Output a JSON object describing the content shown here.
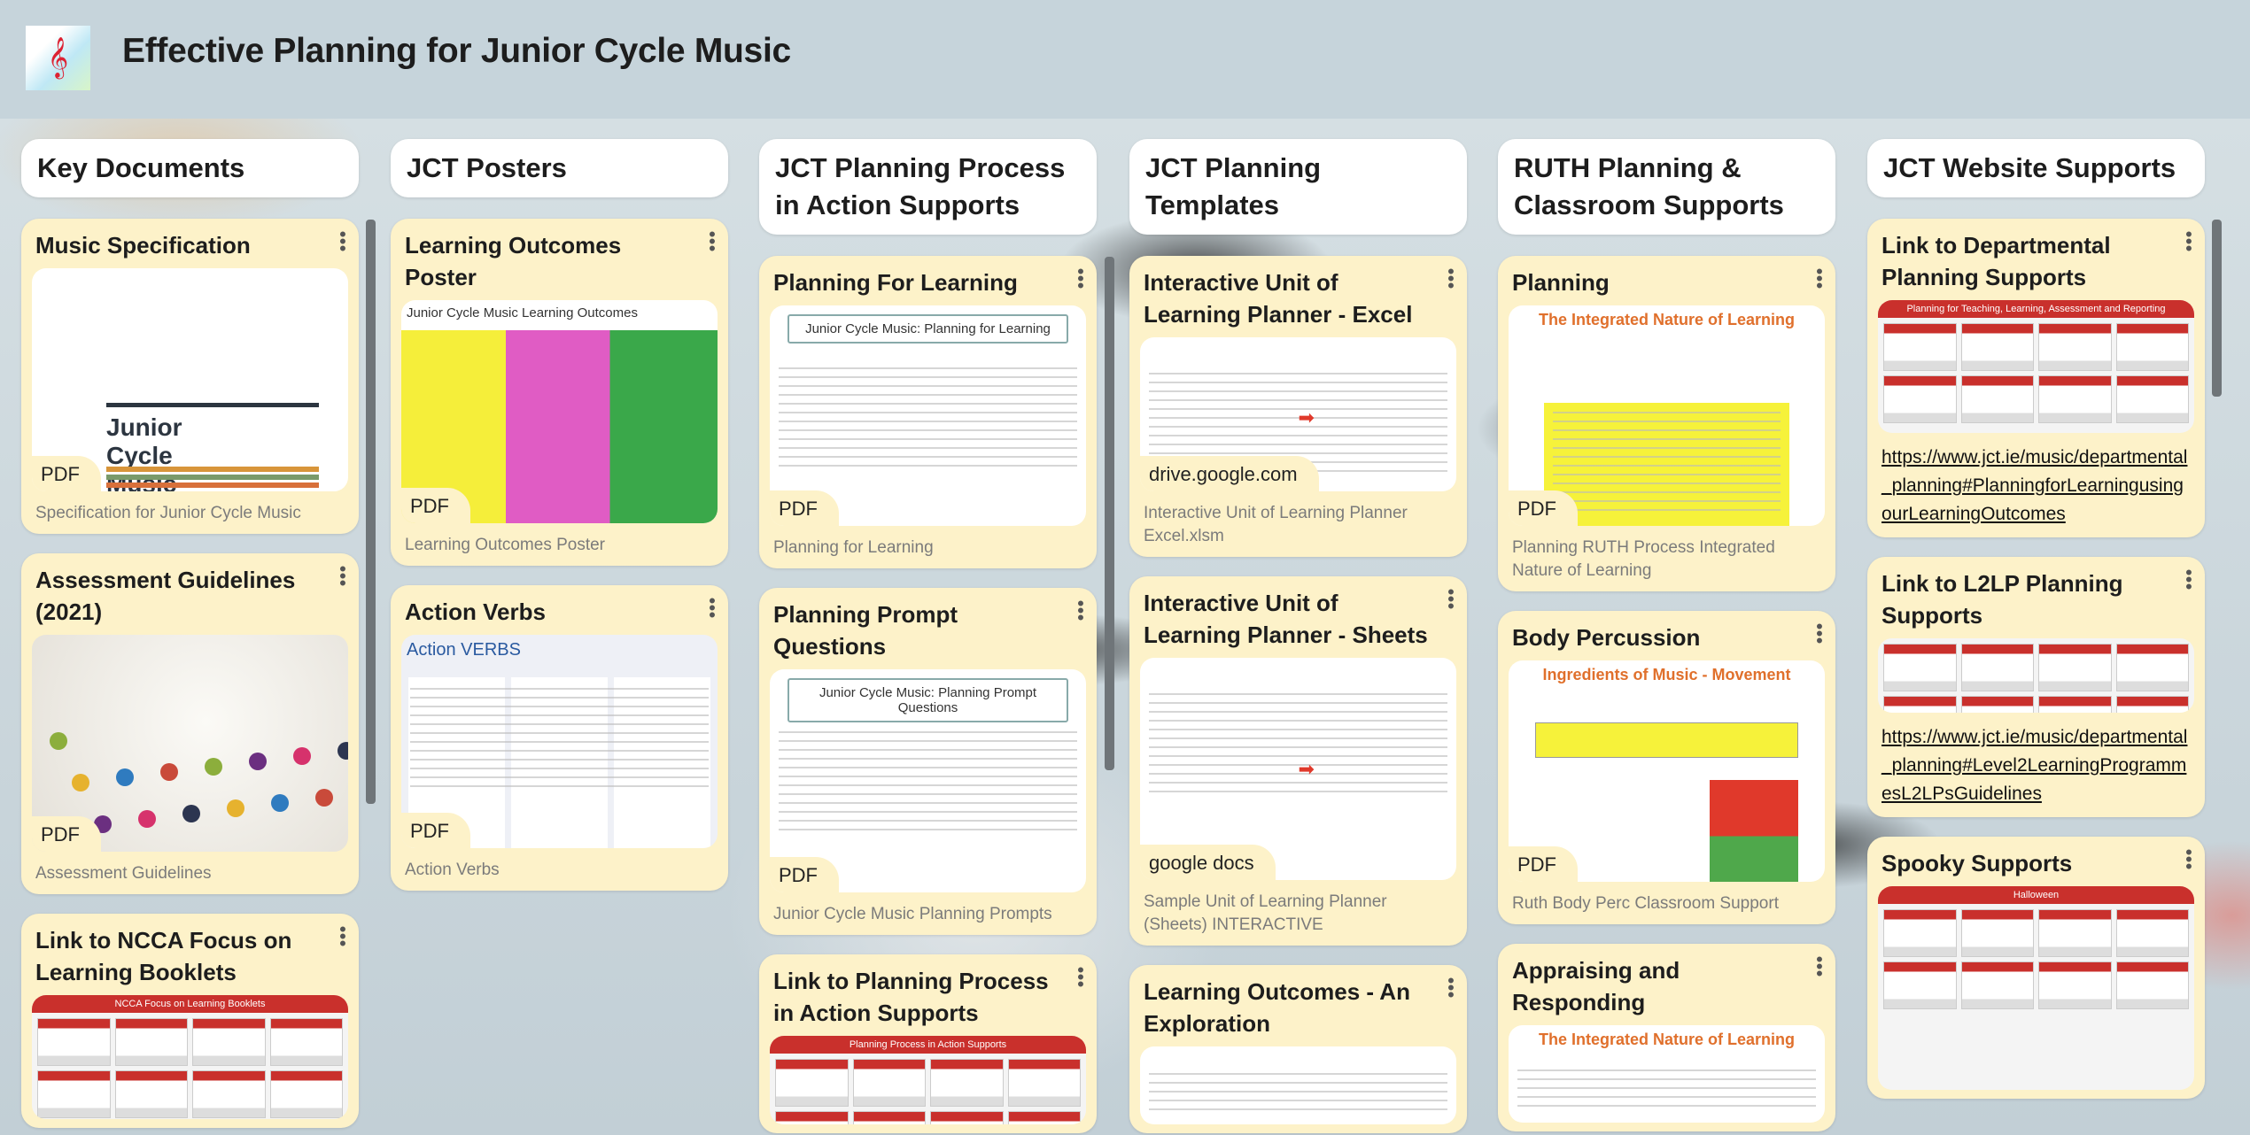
{
  "header": {
    "title": "Effective Planning for Junior Cycle Music",
    "logo_icon": "treble-clef-icon"
  },
  "colors": {
    "card": "#fdf2c9",
    "header_bg": "#c6d4db",
    "column_header": "#ffffff"
  },
  "columns": [
    {
      "title": "Key Documents",
      "cards": [
        {
          "title": "Music Specification",
          "badge": "PDF",
          "caption": "Specification for Junior Cycle Music",
          "thumb_heading": "Junior Cycle Music"
        },
        {
          "title": "Assessment Guidelines (2021)",
          "badge": "PDF",
          "caption": "Assessment Guidelines"
        },
        {
          "title": "Link to NCCA Focus on Learning Booklets",
          "thumb_heading": "NCCA Focus on Learning Booklets"
        }
      ]
    },
    {
      "title": "JCT Posters",
      "cards": [
        {
          "title": "Learning Outcomes Poster",
          "badge": "PDF",
          "caption": "Learning Outcomes Poster",
          "thumb_heading": "Junior Cycle Music Learning Outcomes"
        },
        {
          "title": "Action Verbs",
          "badge": "PDF",
          "caption": "Action Verbs",
          "thumb_heading": "Action VERBS"
        }
      ]
    },
    {
      "title": "JCT Planning Process in Action Supports",
      "cards": [
        {
          "title": "Planning For Learning",
          "badge": "PDF",
          "caption": "Planning for Learning",
          "thumb_heading": "Junior Cycle Music: Planning for Learning"
        },
        {
          "title": "Planning Prompt Questions",
          "badge": "PDF",
          "caption": "Junior Cycle Music Planning Prompts",
          "thumb_heading": "Junior Cycle Music: Planning Prompt Questions"
        },
        {
          "title": "Link to Planning Process in Action Supports",
          "thumb_heading": "Planning Process in Action Supports"
        }
      ]
    },
    {
      "title": "JCT Planning Templates",
      "cards": [
        {
          "title": "Interactive Unit of Learning Planner - Excel",
          "badge": "drive.google.com",
          "caption": "Interactive Unit of Learning Planner Excel.xlsm"
        },
        {
          "title": "Interactive Unit of Learning Planner - Sheets",
          "badge": "google docs",
          "caption": "Sample Unit of Learning Planner (Sheets) INTERACTIVE"
        },
        {
          "title": "Learning Outcomes - An Exploration"
        }
      ]
    },
    {
      "title": "RUTH Planning & Classroom Supports",
      "cards": [
        {
          "title": "Planning",
          "badge": "PDF",
          "caption": "Planning RUTH Process Integrated Nature of Learning",
          "thumb_heading": "The Integrated Nature of Learning"
        },
        {
          "title": "Body Percussion",
          "badge": "PDF",
          "caption": "Ruth Body Perc Classroom Support",
          "thumb_heading": "Ingredients of Music - Movement"
        },
        {
          "title": "Appraising and Responding",
          "thumb_heading": "The Integrated Nature of Learning"
        }
      ]
    },
    {
      "title": "JCT Website Supports",
      "cards": [
        {
          "title": "Link to Departmental Planning Supports",
          "link": "https://www.jct.ie/music/departmental_planning#PlanningforLearningusingourLearningOutcomes",
          "thumb_heading": "Planning for Teaching, Learning, Assessment and Reporting"
        },
        {
          "title": "Link to L2LP Planning Supports",
          "link": "https://www.jct.ie/music/departmental_planning#Level2LearningProgrammesL2LPsGuidelines"
        },
        {
          "title": "Spooky Supports",
          "thumb_heading": "Halloween"
        }
      ]
    }
  ]
}
